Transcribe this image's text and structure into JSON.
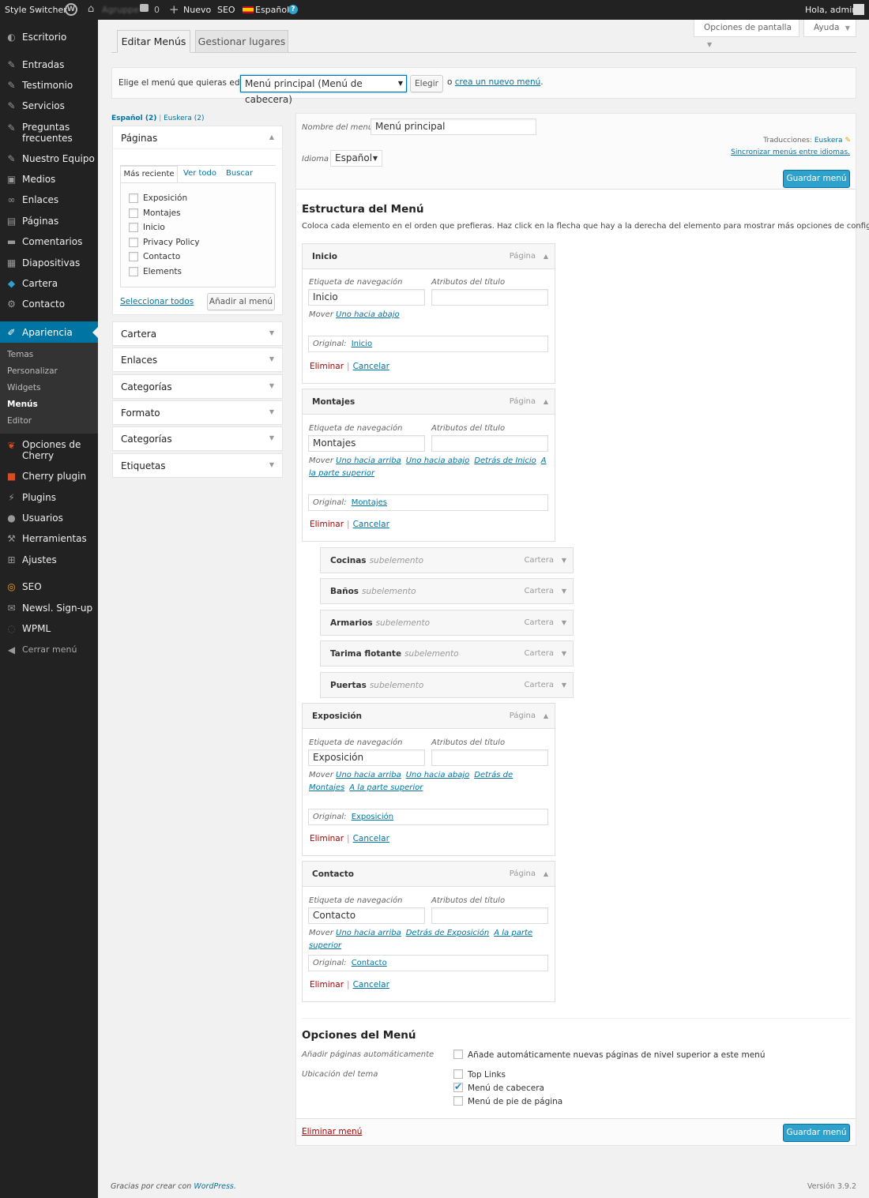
{
  "adminbar": {
    "style_switcher": "Style Switcher",
    "site_name": "Agruppe",
    "comments": "0",
    "new": "Nuevo",
    "seo": "SEO",
    "language": "Español",
    "greeting": "Hola, admin"
  },
  "sidebar": {
    "items": [
      {
        "label": "Escritorio",
        "icon": "dashboard-icon"
      },
      {
        "label": "Entradas",
        "icon": "pin-icon"
      },
      {
        "label": "Testimonio",
        "icon": "pin-icon"
      },
      {
        "label": "Servicios",
        "icon": "pin-icon"
      },
      {
        "label": "Preguntas frecuentes",
        "icon": "pin-icon"
      },
      {
        "label": "Nuestro Equipo",
        "icon": "pin-icon"
      },
      {
        "label": "Medios",
        "icon": "media-icon"
      },
      {
        "label": "Enlaces",
        "icon": "link-icon"
      },
      {
        "label": "Páginas",
        "icon": "page-icon"
      },
      {
        "label": "Comentarios",
        "icon": "comment-icon"
      },
      {
        "label": "Diapositivas",
        "icon": "slides-icon"
      },
      {
        "label": "Cartera",
        "icon": "portfolio-icon"
      },
      {
        "label": "Contacto",
        "icon": "gear-icon"
      },
      {
        "label": "Apariencia",
        "icon": "brush-icon"
      },
      {
        "label": "Opciones de Cherry",
        "icon": "cherry-icon"
      },
      {
        "label": "Cherry plugin",
        "icon": "puzzle-icon"
      },
      {
        "label": "Plugins",
        "icon": "plug-icon"
      },
      {
        "label": "Usuarios",
        "icon": "user-icon"
      },
      {
        "label": "Herramientas",
        "icon": "wrench-icon"
      },
      {
        "label": "Ajustes",
        "icon": "settings-icon"
      },
      {
        "label": "SEO",
        "icon": "seo-icon"
      },
      {
        "label": "Newsl. Sign-up",
        "icon": "mail-icon"
      },
      {
        "label": "WPML",
        "icon": "wpml-icon"
      },
      {
        "label": "Cerrar menú",
        "icon": "collapse-icon"
      }
    ],
    "submenu": [
      "Temas",
      "Personalizar",
      "Widgets",
      "Menús",
      "Editor"
    ]
  },
  "top": {
    "screen_options": "Opciones de pantalla",
    "help": "Ayuda"
  },
  "tabs": {
    "edit": "Editar Menús",
    "manage": "Gestionar lugares"
  },
  "selector": {
    "prompt": "Elige el menú que quieras editar:",
    "selected": "Menú principal (Menú de cabecera)",
    "choose": "Elegir",
    "or": "o",
    "create_link": "crea un nuevo menú",
    "period": "."
  },
  "langs": {
    "es": "Español (2)",
    "eu": "Euskera (2)",
    "sep": "|"
  },
  "pages_box": {
    "title": "Páginas",
    "tabs": [
      "Más reciente",
      "Ver todo",
      "Buscar"
    ],
    "items": [
      "Exposición",
      "Montajes",
      "Inicio",
      "Privacy Policy",
      "Contacto",
      "Elements"
    ],
    "select_all": "Seleccionar todos",
    "add": "Añadir al menú"
  },
  "accordions": [
    "Cartera",
    "Enlaces",
    "Categorías",
    "Formato",
    "Categorías",
    "Etiquetas"
  ],
  "menu_header": {
    "name_label": "Nombre del menú",
    "name_value": "Menú principal",
    "lang_label": "Idioma",
    "lang_value": "Español",
    "translations": "Traducciones:",
    "translation_link": "Euskera",
    "sync": "Sincronizar menús entre idiomas.",
    "save": "Guardar menú"
  },
  "structure": {
    "title": "Estructura del Menú",
    "desc": "Coloca cada elemento en el orden que prefieras. Haz click en la flecha que hay a la derecha del elemento para mostrar más opciones de configuración."
  },
  "labels": {
    "nav_label": "Etiqueta de navegación",
    "title_attr": "Atributos del título",
    "move": "Mover",
    "original": "Original:",
    "delete": "Eliminar",
    "cancel": "Cancelar",
    "sep": "|",
    "subitem": "subelemento"
  },
  "items": [
    {
      "title": "Inicio",
      "type": "Página",
      "nav": "Inicio",
      "moves": [
        "Uno hacia abajo"
      ],
      "original": "Inicio"
    },
    {
      "title": "Montajes",
      "type": "Página",
      "nav": "Montajes",
      "moves": [
        "Uno hacia arriba",
        "Uno hacia abajo",
        "Detrás de Inicio",
        "A la parte superior"
      ],
      "original": "Montajes"
    },
    {
      "title": "Exposición",
      "type": "Página",
      "nav": "Exposición",
      "moves": [
        "Uno hacia arriba",
        "Uno hacia abajo",
        "Detrás de Montajes",
        "A la parte superior"
      ],
      "original": "Exposición"
    },
    {
      "title": "Contacto",
      "type": "Página",
      "nav": "Contacto",
      "moves": [
        "Uno hacia arriba",
        "Detrás de Exposición",
        "A la parte superior"
      ],
      "original": "Contacto"
    }
  ],
  "subitems": [
    {
      "title": "Cocinas",
      "type": "Cartera"
    },
    {
      "title": "Baños",
      "type": "Cartera"
    },
    {
      "title": "Armarios",
      "type": "Cartera"
    },
    {
      "title": "Tarima flotante",
      "type": "Cartera"
    },
    {
      "title": "Puertas",
      "type": "Cartera"
    }
  ],
  "options": {
    "title": "Opciones del Menú",
    "auto_label": "Añadir páginas automáticamente",
    "auto_text": "Añade automáticamente nuevas páginas de nivel superior a este menú",
    "location_label": "Ubicación del tema",
    "locations": [
      {
        "label": "Top Links",
        "checked": false
      },
      {
        "label": "Menú de cabecera",
        "checked": true
      },
      {
        "label": "Menú de pie de página",
        "checked": false
      }
    ]
  },
  "footer": {
    "delete_menu": "Eliminar menú",
    "save": "Guardar menú",
    "thanks": "Gracias por crear con",
    "wp": "WordPress",
    "period": ".",
    "version": "Versión 3.9.2"
  },
  "colors": {
    "accent": "#0074a2",
    "button": "#2ea2cc",
    "sidebar": "#222222",
    "delete": "#aa0000"
  }
}
